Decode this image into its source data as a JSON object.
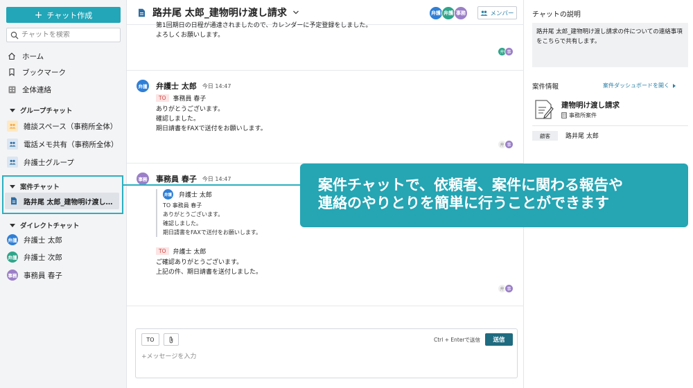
{
  "sidebar": {
    "create_button": "チャット作成",
    "search_placeholder": "チャットを検索",
    "nav": [
      {
        "label": "ホーム"
      },
      {
        "label": "ブックマーク"
      },
      {
        "label": "全体連絡"
      }
    ],
    "group_section": "グループチャット",
    "groups": [
      {
        "label": "雑談スペース（事務所全体）",
        "color": "#f5a940"
      },
      {
        "label": "電話メモ共有（事務所全体）",
        "color": "#2e6da4"
      },
      {
        "label": "弁護士グループ",
        "color": "#2e6da4"
      }
    ],
    "case_section": "案件チャット",
    "case_item": "路井尾 太郎_建物明け渡し…",
    "direct_section": "ダイレクトチャット",
    "directs": [
      {
        "label": "弁護士 太郎",
        "avatar": "弁護",
        "color": "#2f7fd6"
      },
      {
        "label": "弁護士 次郎",
        "avatar": "弁護",
        "color": "#2fa58a"
      },
      {
        "label": "事務員 春子",
        "avatar": "事務",
        "color": "#9b7fc7"
      }
    ]
  },
  "header": {
    "title": "路井尾 太郎_建物明け渡し請求",
    "members": [
      {
        "label": "弁護",
        "color": "#2f7fd6"
      },
      {
        "label": "弁護",
        "color": "#2fa58a"
      },
      {
        "label": "事務",
        "color": "#9b7fc7"
      }
    ],
    "member_button": "メンバー"
  },
  "messages": {
    "first": {
      "lines": [
        "第1回期日の日程が通達されましたので、カレンダーに予定登録をしました。",
        "よろしくお願いします。"
      ],
      "reads": [
        {
          "label": "弁",
          "color": "#2fa58a",
          "text": "#fff"
        },
        {
          "label": "事",
          "color": "#9b7fc7",
          "text": "#fff"
        }
      ]
    },
    "second": {
      "avatar": "弁護",
      "author": "弁護士 太郎",
      "time": "今日 14:47",
      "to_label": "TO",
      "to_name": "事務員 春子",
      "lines": [
        "ありがとうございます。",
        "確認しました。",
        "期日請書をFAXで送付をお願いします。"
      ],
      "reads": [
        {
          "label": "弁",
          "color": "#eeeeee",
          "text": "#888"
        },
        {
          "label": "事",
          "color": "#9b7fc7",
          "text": "#fff"
        }
      ]
    },
    "third": {
      "avatar": "事務",
      "author": "事務員 春子",
      "time": "今日 14:47",
      "quote_avatar": "弁護",
      "quote_author": "弁護士 太郎",
      "quote_lines": [
        "TO 事務員 春子",
        "ありがとうございます。",
        "確認しました。",
        "期日請書をFAXで送付をお願いします。"
      ],
      "to_label": "TO",
      "to_name": "弁護士 太郎",
      "lines": [
        "ご確認ありがとうございます。",
        "上記の件、期日請書を送付しました。"
      ],
      "reads": [
        {
          "label": "弁",
          "color": "#eeeeee",
          "text": "#888"
        },
        {
          "label": "事",
          "color": "#9b7fc7",
          "text": "#fff"
        }
      ]
    }
  },
  "composer": {
    "to_button": "TO",
    "send_hint": "Ctrl + Enterで送信",
    "send_button": "送信",
    "placeholder": "+メッセージを入力"
  },
  "right_panel": {
    "title": "チャットの説明",
    "description": "路井尾 太郎_建物明け渡し請求の件についての連絡事項をこちらで共有します。",
    "case_info_label": "案件情報",
    "dashboard_link": "案件ダッシュボードを開く",
    "case_name": "建物明け渡し請求",
    "case_type": "事務所案件",
    "client_badge": "顧客",
    "client_name": "路井尾 太郎"
  },
  "callout": {
    "line1": "案件チャットで、依頼者、案件に関わる報告や",
    "line2": "連絡のやりとりを簡単に行うことができます"
  }
}
